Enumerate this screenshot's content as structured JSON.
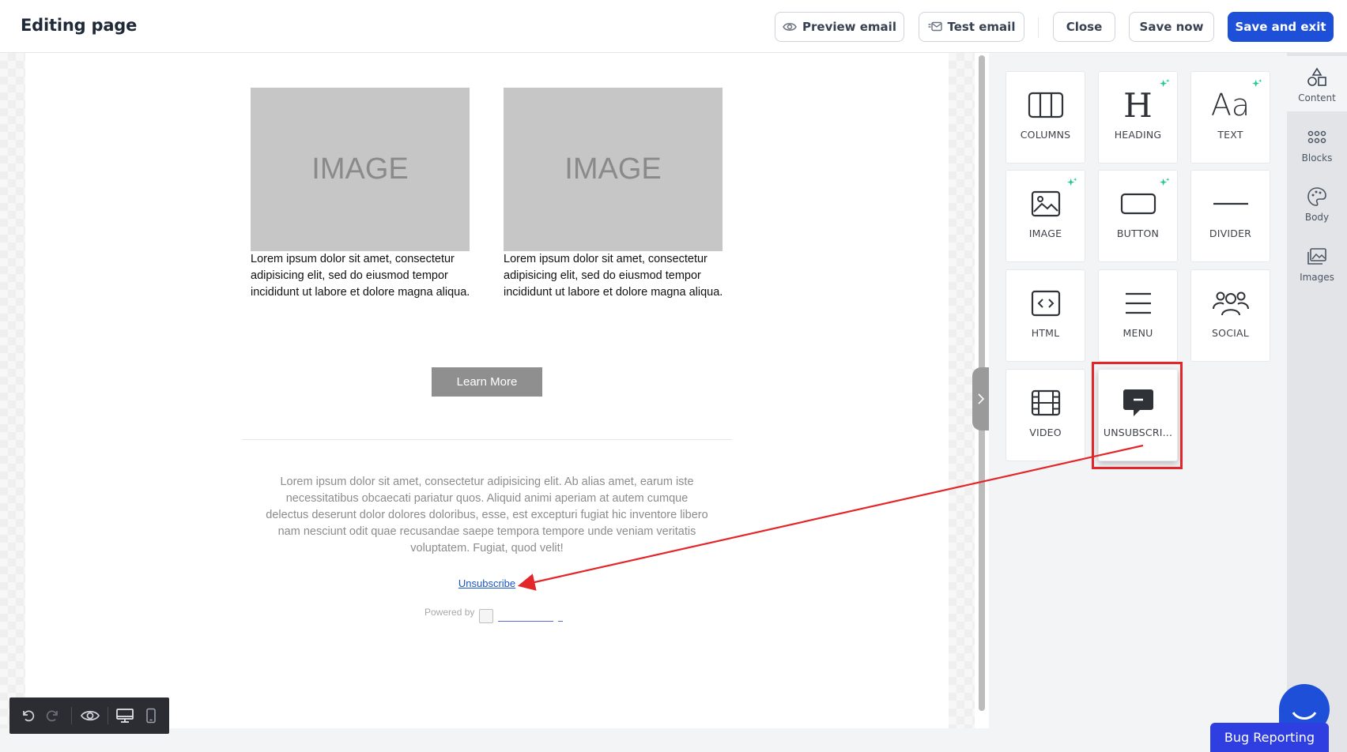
{
  "header": {
    "title": "Editing page",
    "preview_label": "Preview email",
    "test_label": "Test email",
    "close_label": "Close",
    "save_now_label": "Save now",
    "save_exit_label": "Save and exit"
  },
  "email": {
    "image_placeholder": "IMAGE",
    "col1_text": "Lorem ipsum dolor sit amet, consectetur adipisicing elit, sed do eiusmod tempor incididunt ut labore et dolore magna aliqua.",
    "col2_text": "Lorem ipsum dolor sit amet, consectetur adipisicing elit, sed do eiusmod tempor incididunt ut labore et dolore magna aliqua.",
    "button_label": "Learn More",
    "footer_text": "Lorem ipsum dolor sit amet, consectetur adipisicing elit. Ab alias amet, earum iste necessitatibus obcaecati pariatur quos. Aliquid animi aperiam at autem cumque delectus deserunt dolor dolores doloribus, esse, est excepturi fugiat hic inventore libero nam nesciunt odit quae recusandae saepe tempora tempore unde veniam veritatis voluptatem. Fugiat, quod velit!",
    "unsubscribe_label": "Unsubscribe",
    "powered_by": "Powered by"
  },
  "panel": {
    "tiles": [
      {
        "label": "COLUMNS",
        "icon": "columns-icon",
        "ai": false
      },
      {
        "label": "HEADING",
        "icon": "heading-icon",
        "ai": true
      },
      {
        "label": "TEXT",
        "icon": "text-icon",
        "ai": true
      },
      {
        "label": "IMAGE",
        "icon": "image-icon",
        "ai": true
      },
      {
        "label": "BUTTON",
        "icon": "button-icon",
        "ai": true
      },
      {
        "label": "DIVIDER",
        "icon": "divider-icon",
        "ai": false
      },
      {
        "label": "HTML",
        "icon": "html-icon",
        "ai": false
      },
      {
        "label": "MENU",
        "icon": "menu-icon",
        "ai": false
      },
      {
        "label": "SOCIAL",
        "icon": "social-icon",
        "ai": false
      },
      {
        "label": "VIDEO",
        "icon": "video-icon",
        "ai": false
      },
      {
        "label": "UNSUBSCRI...",
        "icon": "unsubscribe-icon",
        "ai": false
      }
    ],
    "heading_glyph": "H",
    "text_glyph": "Aa"
  },
  "rail": {
    "items": [
      {
        "label": "Content",
        "icon": "shapes-icon"
      },
      {
        "label": "Blocks",
        "icon": "grid-icon"
      },
      {
        "label": "Body",
        "icon": "palette-icon"
      },
      {
        "label": "Images",
        "icon": "images-icon"
      }
    ]
  },
  "bug_label": "Bug Reporting",
  "colors": {
    "primary": "#1d4fd8",
    "highlight": "#e3262a",
    "ai_sparkle": "#20c997"
  }
}
